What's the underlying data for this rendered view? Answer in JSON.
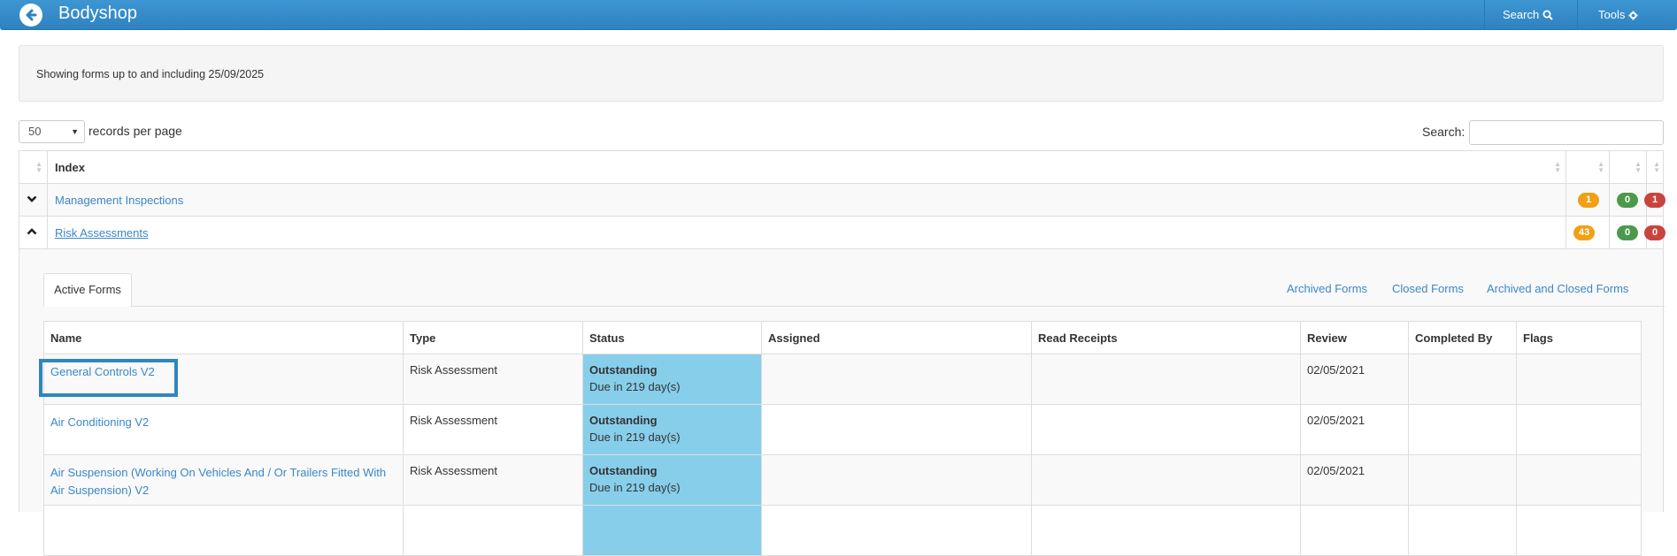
{
  "header": {
    "title": "Bodyshop",
    "search_label": "Search",
    "tools_label": "Tools"
  },
  "info": {
    "text": "Showing forms up to and including 25/09/2025"
  },
  "controls": {
    "per_page_value": "50",
    "per_page_label": "records per page",
    "search_label": "Search:",
    "search_value": ""
  },
  "index_table": {
    "header": "Index",
    "rows": [
      {
        "label": "Management Inspections",
        "expanded": false,
        "counts": [
          "1",
          "0",
          "1"
        ]
      },
      {
        "label": "Risk Assessments",
        "expanded": true,
        "counts": [
          "43",
          "0",
          "0"
        ]
      }
    ]
  },
  "tabs": {
    "active": "Active Forms",
    "links": [
      "Archived Forms",
      "Closed Forms",
      "Archived and Closed Forms"
    ]
  },
  "forms_table": {
    "columns": [
      "Name",
      "Type",
      "Status",
      "Assigned",
      "Read Receipts",
      "Review",
      "Completed By",
      "Flags"
    ],
    "rows": [
      {
        "name": "General Controls V2",
        "type": "Risk Assessment",
        "status": "Outstanding",
        "due": "Due in 219 day(s)",
        "assigned": "",
        "read_receipts": "",
        "review": "02/05/2021",
        "completed_by": "",
        "flags": ""
      },
      {
        "name": "Air Conditioning V2",
        "type": "Risk Assessment",
        "status": "Outstanding",
        "due": "Due in 219 day(s)",
        "assigned": "",
        "read_receipts": "",
        "review": "02/05/2021",
        "completed_by": "",
        "flags": ""
      },
      {
        "name": "Air Suspension (Working On Vehicles And / Or Trailers Fitted With Air Suspension) V2",
        "type": "Risk Assessment",
        "status": "Outstanding",
        "due": "Due in 219 day(s)",
        "assigned": "",
        "read_receipts": "",
        "review": "02/05/2021",
        "completed_by": "",
        "flags": ""
      }
    ]
  },
  "colors": {
    "navbar": "#2f82c0",
    "link": "#3a87c8",
    "status_outstanding": "#87ceeb",
    "badge_orange": "#f0a015",
    "badge_green": "#4b9a4b",
    "badge_red": "#c9433f"
  },
  "icons": {
    "back": "arrow-left-circle-icon",
    "search": "magnifier-icon",
    "tools": "gear-icon",
    "collapse": "chevron-down-icon",
    "expand": "chevron-up-icon",
    "sort": "sort-icon"
  }
}
